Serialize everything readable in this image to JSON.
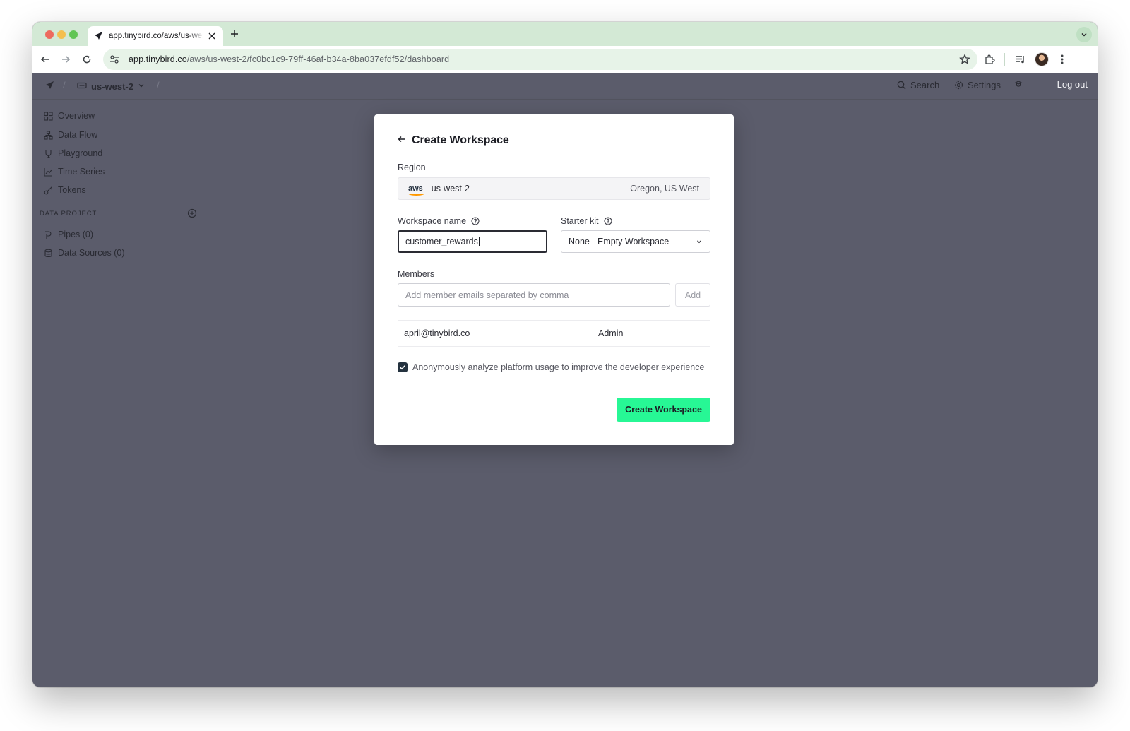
{
  "browser": {
    "tab_title": "app.tinybird.co/aws/us-west-2/fc0bc1c9-79ff-46af-b34a-8ba037efdf52/dashboard",
    "url_host": "app.tinybird.co",
    "url_path": "/aws/us-west-2/fc0bc1c9-79ff-46af-b34a-8ba037efdf52/dashboard"
  },
  "header": {
    "region": "us-west-2",
    "search_label": "Search",
    "settings_label": "Settings",
    "logout_label": "Log out"
  },
  "sidebar": {
    "items": [
      {
        "label": "Overview",
        "icon": "grid-icon"
      },
      {
        "label": "Data Flow",
        "icon": "data-flow-icon"
      },
      {
        "label": "Playground",
        "icon": "playground-icon"
      },
      {
        "label": "Time Series",
        "icon": "chart-icon"
      },
      {
        "label": "Tokens",
        "icon": "key-icon"
      }
    ],
    "section_label": "DATA PROJECT",
    "project_items": [
      {
        "label": "Pipes (0)",
        "icon": "pipe-icon"
      },
      {
        "label": "Data Sources (0)",
        "icon": "database-icon"
      }
    ]
  },
  "modal": {
    "title": "Create Workspace",
    "region_label": "Region",
    "region_provider": "aws",
    "region_code": "us-west-2",
    "region_name": "Oregon, US West",
    "workspace_name_label": "Workspace name",
    "workspace_name_value": "customer_rewards",
    "starter_kit_label": "Starter kit",
    "starter_kit_value": "None - Empty Workspace",
    "members_label": "Members",
    "members_placeholder": "Add member emails separated by comma",
    "add_label": "Add",
    "members": [
      {
        "email": "april@tinybird.co",
        "role": "Admin"
      }
    ],
    "consent_label": "Anonymously analyze platform usage to improve the developer experience",
    "consent_checked": true,
    "create_label": "Create Workspace"
  },
  "colors": {
    "overlay": "#5b5c6b",
    "accent": "#27f795",
    "tabstrip": "#d3e9d5"
  }
}
